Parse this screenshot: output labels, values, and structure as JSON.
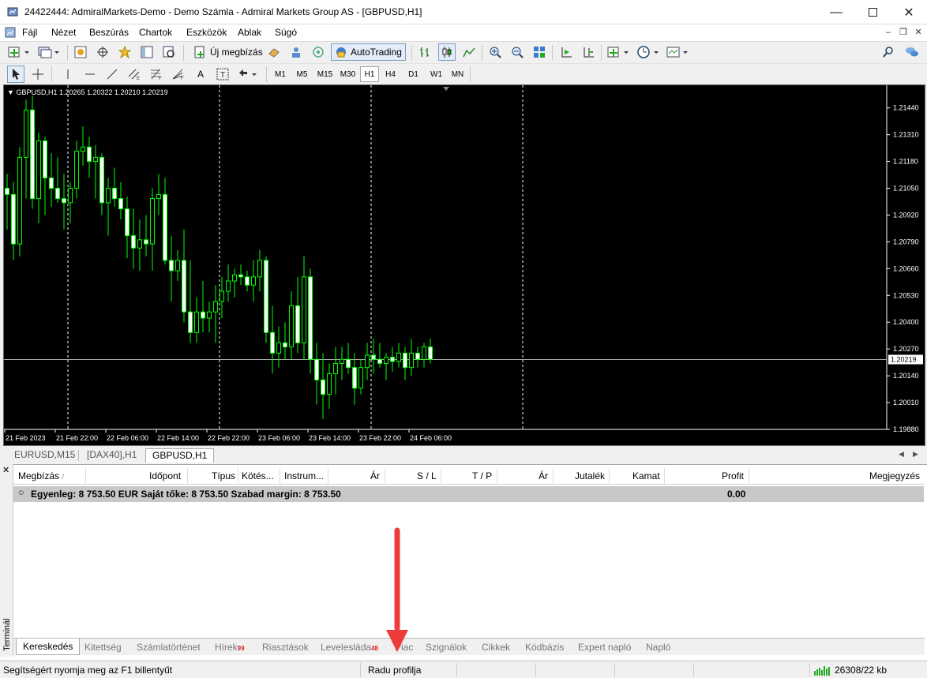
{
  "window": {
    "title": "24422444: AdmiralMarkets-Demo - Demo Számla - Admiral Markets Group AS - [GBPUSD,H1]"
  },
  "menu": [
    "Fájl",
    "Nézet",
    "Beszúrás",
    "Chartok",
    "Eszközök",
    "Ablak",
    "Súgó"
  ],
  "toolbar": {
    "new_order_label": "Új megbízás",
    "autotrading_label": "AutoTrading",
    "timeframes": [
      "M1",
      "M5",
      "M15",
      "M30",
      "H1",
      "H4",
      "D1",
      "W1",
      "MN"
    ],
    "active_timeframe": "H1"
  },
  "chart": {
    "header": "GBPUSD,H1  1.20265 1.20322 1.20210 1.20219",
    "current_price": "1.20219",
    "price_labels": [
      "1.21440",
      "1.21310",
      "1.21180",
      "1.21050",
      "1.20920",
      "1.20790",
      "1.20660",
      "1.20530",
      "1.20400",
      "1.20270",
      "1.20140",
      "1.20010",
      "1.19880"
    ],
    "time_labels": [
      "21 Feb 2023",
      "21 Feb 22:00",
      "22 Feb 06:00",
      "22 Feb 14:00",
      "22 Feb 22:00",
      "23 Feb 06:00",
      "23 Feb 14:00",
      "23 Feb 22:00",
      "24 Feb 06:00"
    ],
    "colors": {
      "bull": "#00ff00",
      "bear": "#00ff00",
      "bull_body": "#000000",
      "bear_body": "#ffffff",
      "grid": "#ffffff",
      "bid_line": "#aaaaaa"
    }
  },
  "chart_data": {
    "type": "candlestick",
    "symbol": "GBPUSD",
    "timeframe": "H1",
    "ylim": [
      1.1988,
      1.2155
    ],
    "candles": [
      [
        1.2105,
        1.2112,
        1.2085,
        1.2102
      ],
      [
        1.2102,
        1.2108,
        1.207,
        1.2078
      ],
      [
        1.2078,
        1.2125,
        1.2072,
        1.212
      ],
      [
        1.212,
        1.2148,
        1.21,
        1.2143
      ],
      [
        1.2143,
        1.215,
        1.2095,
        1.21
      ],
      [
        1.21,
        1.2132,
        1.2088,
        1.2128
      ],
      [
        1.2128,
        1.213,
        1.2092,
        1.211
      ],
      [
        1.211,
        1.2122,
        1.2096,
        1.2105
      ],
      [
        1.2105,
        1.212,
        1.2098,
        1.21
      ],
      [
        1.21,
        1.2112,
        1.2085,
        1.2098
      ],
      [
        1.2098,
        1.2108,
        1.2088,
        1.2105
      ],
      [
        1.2105,
        1.2128,
        1.21,
        1.2123
      ],
      [
        1.2123,
        1.2135,
        1.2116,
        1.2125
      ],
      [
        1.2125,
        1.213,
        1.211,
        1.2118
      ],
      [
        1.2118,
        1.2126,
        1.21,
        1.212
      ],
      [
        1.212,
        1.2122,
        1.2092,
        1.2098
      ],
      [
        1.2098,
        1.211,
        1.2082,
        1.2105
      ],
      [
        1.2105,
        1.2115,
        1.2096,
        1.21
      ],
      [
        1.21,
        1.2108,
        1.209,
        1.2095
      ],
      [
        1.2095,
        1.2101,
        1.2071,
        1.2082
      ],
      [
        1.2082,
        1.2095,
        1.2066,
        1.2076
      ],
      [
        1.2076,
        1.209,
        1.2065,
        1.208
      ],
      [
        1.208,
        1.2092,
        1.2072,
        1.2078
      ],
      [
        1.2078,
        1.2105,
        1.2065,
        1.21
      ],
      [
        1.21,
        1.2112,
        1.2092,
        1.2102
      ],
      [
        1.2102,
        1.211,
        1.2068,
        1.207
      ],
      [
        1.207,
        1.2082,
        1.205,
        1.2065
      ],
      [
        1.2065,
        1.2075,
        1.206,
        1.207
      ],
      [
        1.207,
        1.2085,
        1.204,
        1.2045
      ],
      [
        1.2045,
        1.207,
        1.203,
        1.2035
      ],
      [
        1.2035,
        1.2052,
        1.203,
        1.2045
      ],
      [
        1.2045,
        1.206,
        1.2035,
        1.2042
      ],
      [
        1.2042,
        1.205,
        1.2035,
        1.2045
      ],
      [
        1.2045,
        1.2058,
        1.203,
        1.205
      ],
      [
        1.205,
        1.2062,
        1.2042,
        1.2055
      ],
      [
        1.2055,
        1.2068,
        1.205,
        1.206
      ],
      [
        1.206,
        1.2066,
        1.2052,
        1.2063
      ],
      [
        1.2063,
        1.2068,
        1.2058,
        1.2062
      ],
      [
        1.2062,
        1.2065,
        1.2055,
        1.2058
      ],
      [
        1.2058,
        1.207,
        1.205,
        1.2062
      ],
      [
        1.2062,
        1.2075,
        1.2055,
        1.207
      ],
      [
        1.207,
        1.2072,
        1.203,
        1.2035
      ],
      [
        1.2035,
        1.2048,
        1.2015,
        1.2025
      ],
      [
        1.2025,
        1.2038,
        1.2018,
        1.203
      ],
      [
        1.203,
        1.204,
        1.2022,
        1.2028
      ],
      [
        1.2028,
        1.2055,
        1.2022,
        1.2048
      ],
      [
        1.2048,
        1.2062,
        1.2025,
        1.203
      ],
      [
        1.203,
        1.2072,
        1.2022,
        1.2062
      ],
      [
        1.2062,
        1.2066,
        1.2015,
        1.2022
      ],
      [
        1.2022,
        1.203,
        1.2,
        1.2012
      ],
      [
        1.2012,
        1.2025,
        1.1993,
        1.2005
      ],
      [
        1.2005,
        1.202,
        1.1998,
        1.2015
      ],
      [
        1.2015,
        1.2028,
        1.2005,
        1.202
      ],
      [
        1.202,
        1.2028,
        1.2012,
        1.2022
      ],
      [
        1.2022,
        1.203,
        1.2015,
        1.2018
      ],
      [
        1.2018,
        1.2025,
        1.2,
        1.2008
      ],
      [
        1.2008,
        1.2022,
        1.2005,
        1.2018
      ],
      [
        1.2018,
        1.203,
        1.2012,
        1.2024
      ],
      [
        1.2024,
        1.2032,
        1.2015,
        1.2022
      ],
      [
        1.2022,
        1.203,
        1.2018,
        1.202
      ],
      [
        1.202,
        1.2025,
        1.2012,
        1.2023
      ],
      [
        1.2023,
        1.2028,
        1.2016,
        1.2021
      ],
      [
        1.2021,
        1.203,
        1.2018,
        1.2025
      ],
      [
        1.2025,
        1.2028,
        1.2012,
        1.2018
      ],
      [
        1.2018,
        1.2032,
        1.2014,
        1.2025
      ],
      [
        1.2025,
        1.2028,
        1.2018,
        1.2022
      ],
      [
        1.2022,
        1.203,
        1.2018,
        1.2028
      ],
      [
        1.2028,
        1.2032,
        1.202,
        1.2022
      ]
    ]
  },
  "chart_tabs": [
    "EURUSD,M15",
    "[DAX40],H1",
    "GBPUSD,H1"
  ],
  "active_chart_tab": "GBPUSD,H1",
  "terminal": {
    "side_label": "Terminál",
    "columns": [
      "Megbízás",
      "Időpont",
      "Típus",
      "Kötés...",
      "Instrum...",
      "Ár",
      "S / L",
      "T / P",
      "Ár",
      "Jutalék",
      "Kamat",
      "Profit",
      "Megjegyzés"
    ],
    "balance_row": "Egyenleg: 8 753.50 EUR  Saját tőke: 8 753.50  Szabad margin: 8 753.50",
    "balance_profit": "0.00",
    "tabs": [
      "Kereskedés",
      "Kitettség",
      "Számlatörténet",
      "Hírek",
      "Riasztások",
      "Levelesláda",
      "Piac",
      "Szignálok",
      "Cikkek",
      "Kódbázis",
      "Expert napló",
      "Napló"
    ],
    "news_badge": "99",
    "mail_badge": "48",
    "active_tab": "Kereskedés"
  },
  "status": {
    "help": "Segítségért nyomja meg az F1 billentyűt",
    "profile": "Radu profilja",
    "traffic": "26308/22 kb"
  }
}
